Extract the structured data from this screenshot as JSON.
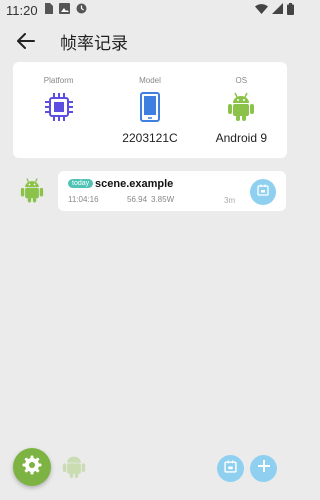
{
  "status_bar": {
    "time": "11:20",
    "icons": [
      "sim-card-icon",
      "image-icon",
      "clock-icon",
      "wifi-icon",
      "signal-icon",
      "battery-icon"
    ]
  },
  "app_bar": {
    "title": "帧率记录",
    "back_icon": "arrow-back-icon"
  },
  "device_info": {
    "platform": {
      "label": "Platform",
      "icon": "chip-icon",
      "value": ""
    },
    "model": {
      "label": "Model",
      "icon": "phone-icon",
      "value": "2203121C"
    },
    "os": {
      "label": "OS",
      "icon": "android-icon",
      "value": "Android 9"
    }
  },
  "records": [
    {
      "badge": "today",
      "title": "scene.example",
      "time": "11:04:16",
      "fps": "56.94",
      "power": "3.85W",
      "duration": "3m",
      "delete_icon": "calendar-delete-icon"
    }
  ],
  "bottom_bar": {
    "settings_icon": "gear-icon",
    "app_icon": "android-icon",
    "delete_icon": "calendar-delete-icon",
    "add_icon": "plus-icon"
  },
  "colors": {
    "android_green": "#8bc34a",
    "accent_blue": "#8fd0f0",
    "badge_teal": "#4fc3b5",
    "chip_purple": "#5b4ee0",
    "phone_blue": "#3f7fe0"
  }
}
